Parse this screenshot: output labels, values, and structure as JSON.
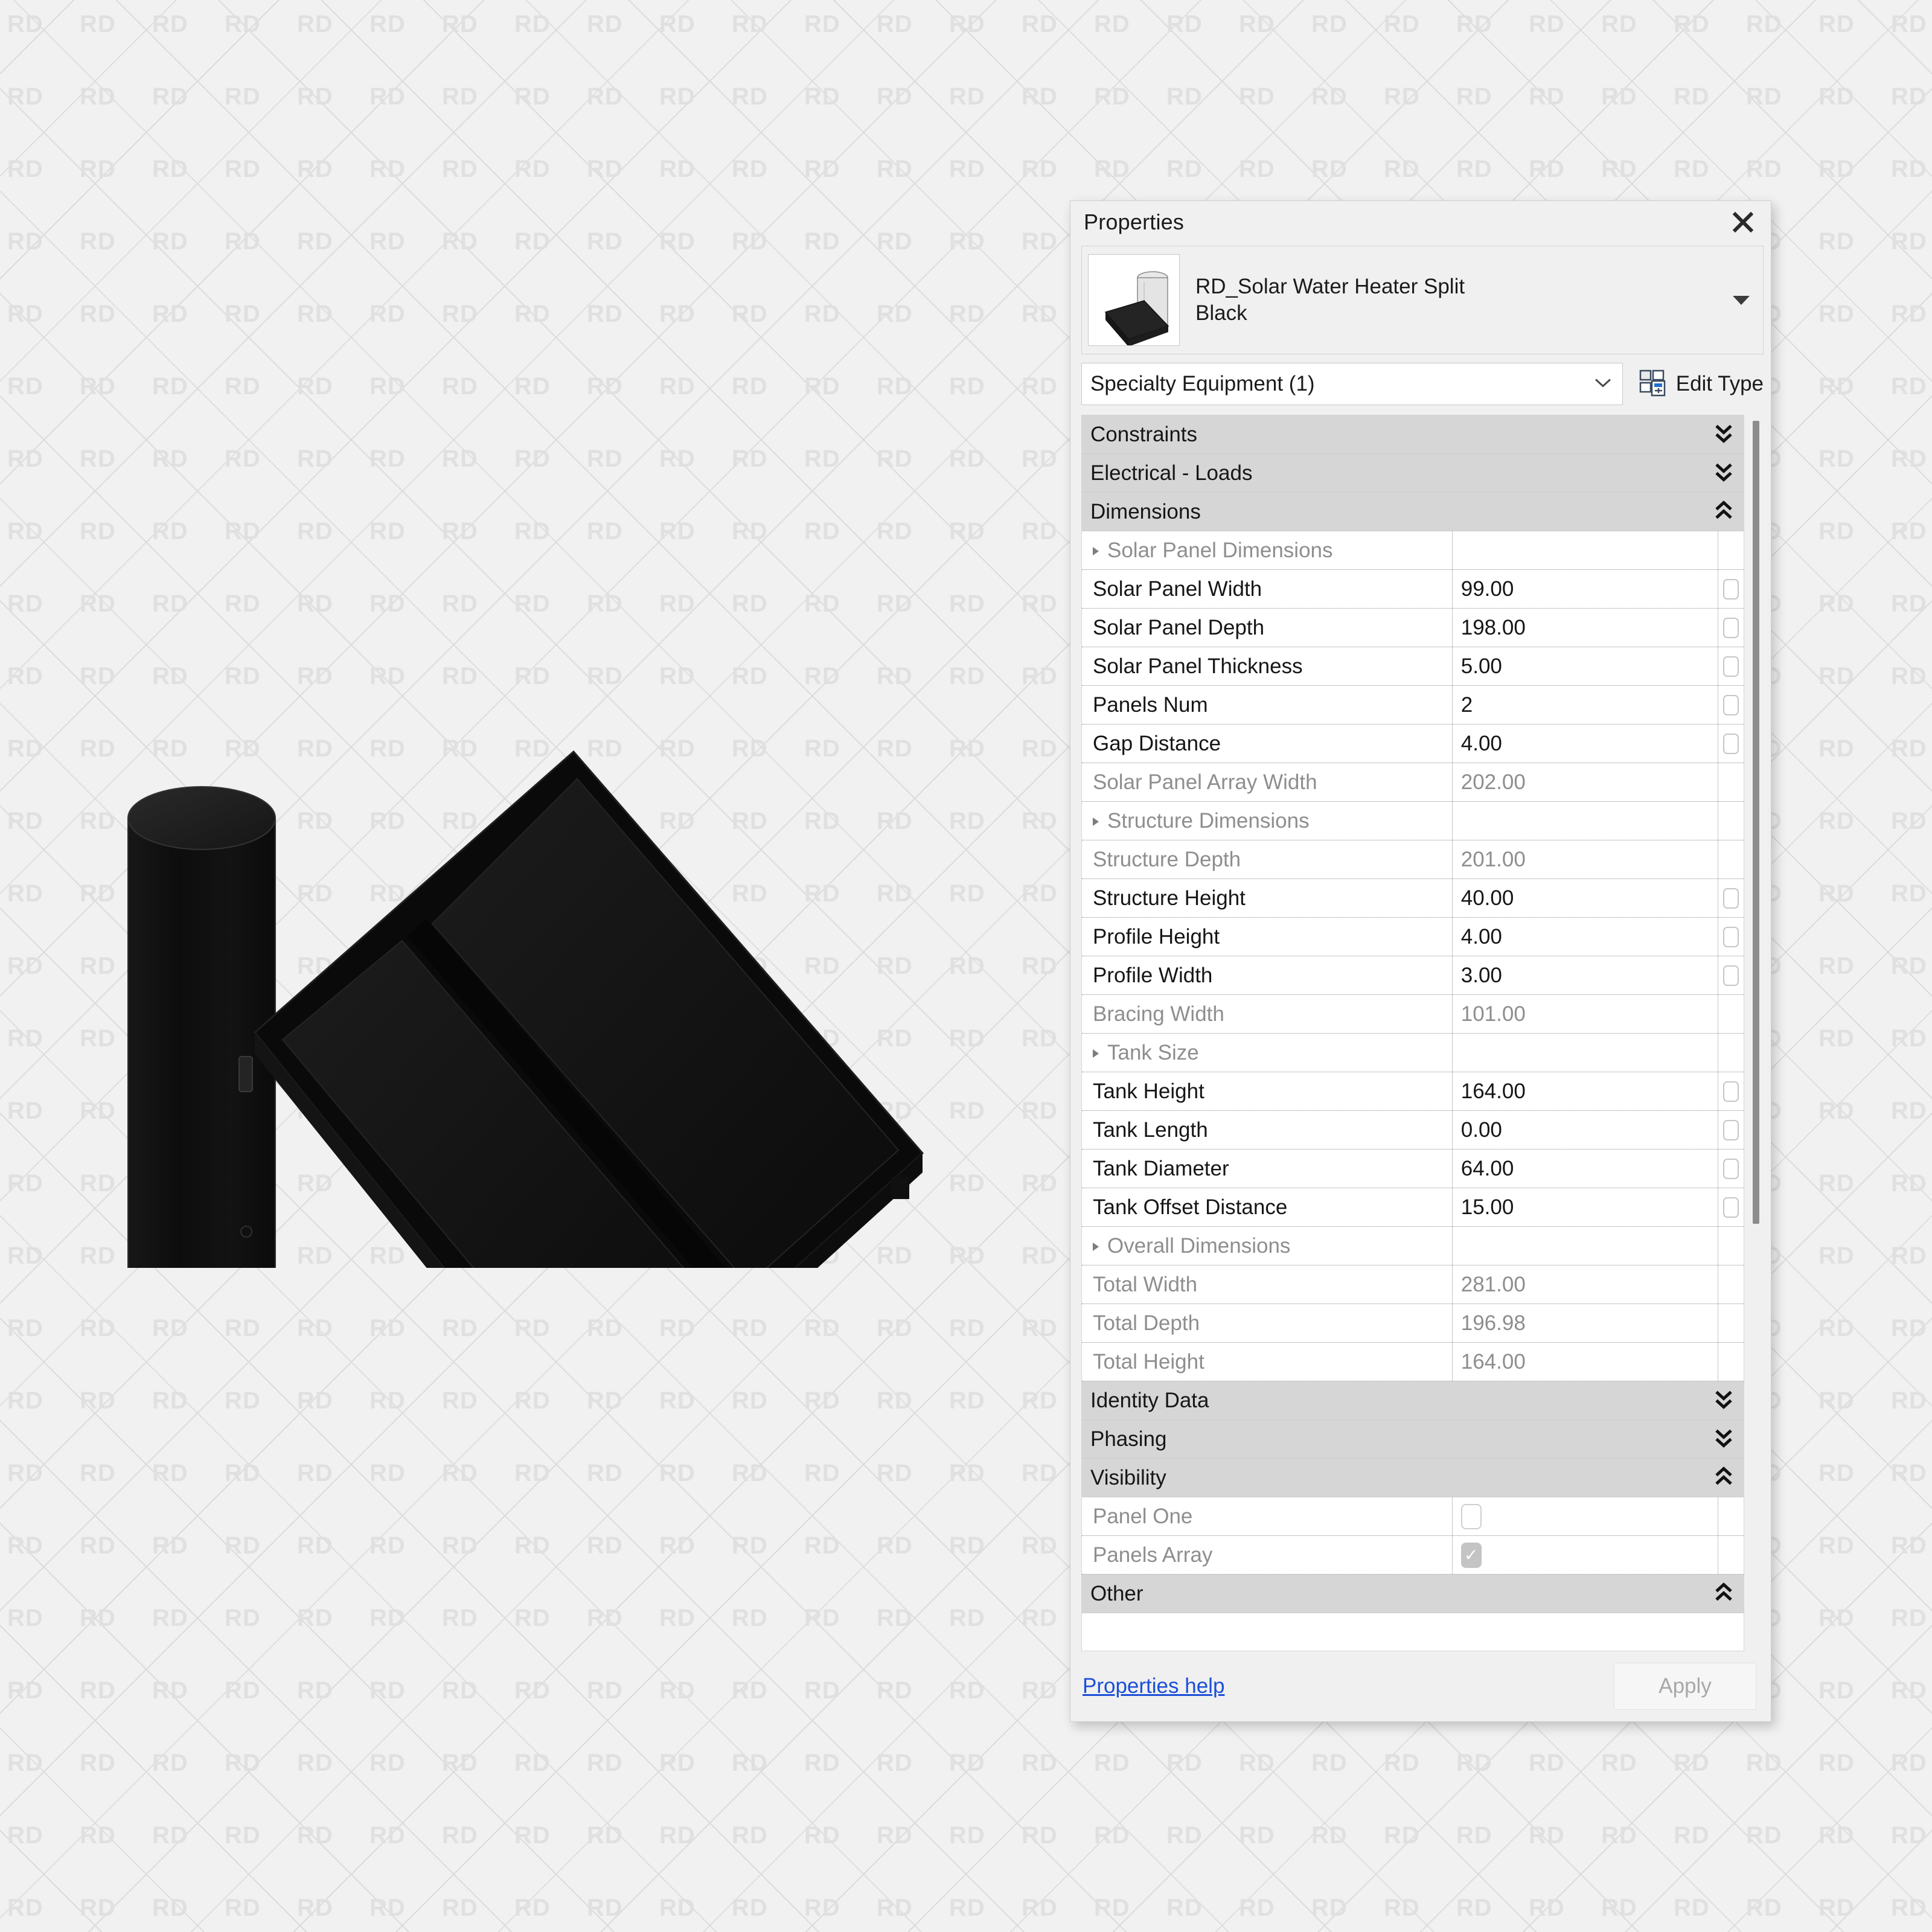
{
  "watermark": {
    "text": "RD"
  },
  "palette": {
    "title": "Properties",
    "close_icon": "close-icon",
    "type": {
      "name": "RD_Solar Water Heater Split Black",
      "name_line1": "RD_Solar Water Heater Split",
      "name_line2": "Black",
      "caret_icon": "caret-down-icon",
      "thumbnail_icon": "solar-water-heater-thumbnail"
    },
    "category": {
      "value": "Specialty Equipment (1)",
      "chevron_icon": "chevron-down-icon"
    },
    "edit_type": {
      "label": "Edit Type",
      "icon": "edit-type-icon"
    },
    "sections": [
      {
        "name": "Constraints",
        "state": "collapsed",
        "chevron_icon": "double-chevron-down-icon",
        "rows": []
      },
      {
        "name": "Electrical - Loads",
        "state": "collapsed",
        "chevron_icon": "double-chevron-down-icon",
        "rows": []
      },
      {
        "name": "Dimensions",
        "state": "expanded",
        "chevron_icon": "double-chevron-up-icon",
        "rows": [
          {
            "label": "Solar Panel Dimensions",
            "value": "",
            "kind": "group",
            "readonly": true,
            "lock": false
          },
          {
            "label": "Solar Panel Width",
            "value": "99.00",
            "kind": "value",
            "readonly": false,
            "lock": true
          },
          {
            "label": "Solar Panel Depth",
            "value": "198.00",
            "kind": "value",
            "readonly": false,
            "lock": true
          },
          {
            "label": "Solar Panel Thickness",
            "value": "5.00",
            "kind": "value",
            "readonly": false,
            "lock": true
          },
          {
            "label": "Panels Num",
            "value": "2",
            "kind": "value",
            "readonly": false,
            "lock": true
          },
          {
            "label": "Gap Distance",
            "value": "4.00",
            "kind": "value",
            "readonly": false,
            "lock": true
          },
          {
            "label": "Solar Panel Array Width",
            "value": "202.00",
            "kind": "value",
            "readonly": true,
            "lock": false
          },
          {
            "label": "Structure Dimensions",
            "value": "",
            "kind": "group",
            "readonly": true,
            "lock": false
          },
          {
            "label": "Structure Depth",
            "value": "201.00",
            "kind": "value",
            "readonly": true,
            "lock": false
          },
          {
            "label": "Structure Height",
            "value": "40.00",
            "kind": "value",
            "readonly": false,
            "lock": true
          },
          {
            "label": "Profile Height",
            "value": "4.00",
            "kind": "value",
            "readonly": false,
            "lock": true
          },
          {
            "label": "Profile Width",
            "value": "3.00",
            "kind": "value",
            "readonly": false,
            "lock": true
          },
          {
            "label": "Bracing Width",
            "value": "101.00",
            "kind": "value",
            "readonly": true,
            "lock": false
          },
          {
            "label": "Tank Size",
            "value": "",
            "kind": "group",
            "readonly": true,
            "lock": false
          },
          {
            "label": "Tank Height",
            "value": "164.00",
            "kind": "value",
            "readonly": false,
            "lock": true
          },
          {
            "label": "Tank Length",
            "value": "0.00",
            "kind": "value",
            "readonly": false,
            "lock": true
          },
          {
            "label": "Tank Diameter",
            "value": "64.00",
            "kind": "value",
            "readonly": false,
            "lock": true
          },
          {
            "label": "Tank Offset Distance",
            "value": "15.00",
            "kind": "value",
            "readonly": false,
            "lock": true
          },
          {
            "label": "Overall Dimensions",
            "value": "",
            "kind": "group",
            "readonly": true,
            "lock": false
          },
          {
            "label": "Total Width",
            "value": "281.00",
            "kind": "value",
            "readonly": true,
            "lock": false
          },
          {
            "label": "Total Depth",
            "value": "196.98",
            "kind": "value",
            "readonly": true,
            "lock": false
          },
          {
            "label": "Total Height",
            "value": "164.00",
            "kind": "value",
            "readonly": true,
            "lock": false
          }
        ]
      },
      {
        "name": "Identity Data",
        "state": "collapsed",
        "chevron_icon": "double-chevron-down-icon",
        "rows": []
      },
      {
        "name": "Phasing",
        "state": "collapsed",
        "chevron_icon": "double-chevron-down-icon",
        "rows": []
      },
      {
        "name": "Visibility",
        "state": "expanded",
        "chevron_icon": "double-chevron-up-icon",
        "rows": [
          {
            "label": "Panel One",
            "value": "",
            "kind": "checkbox",
            "checked": false,
            "readonly": true,
            "lock": false
          },
          {
            "label": "Panels Array",
            "value": "",
            "kind": "checkbox",
            "checked": true,
            "readonly": true,
            "lock": false
          }
        ]
      },
      {
        "name": "Other",
        "state": "expanded",
        "chevron_icon": "double-chevron-up-icon",
        "rows": []
      }
    ],
    "footer": {
      "help_label": "Properties help",
      "apply_label": "Apply",
      "apply_enabled": false
    },
    "scrollbar": {
      "present": true
    }
  },
  "colors": {
    "panel_bg": "#f0f0f0",
    "section_bg": "#d6d6d6",
    "grid_bg": "#ffffff",
    "link": "#1b4fd8",
    "readonly_text": "#8e8e8e",
    "text": "#161616",
    "watermark": "#e0e0e0"
  }
}
